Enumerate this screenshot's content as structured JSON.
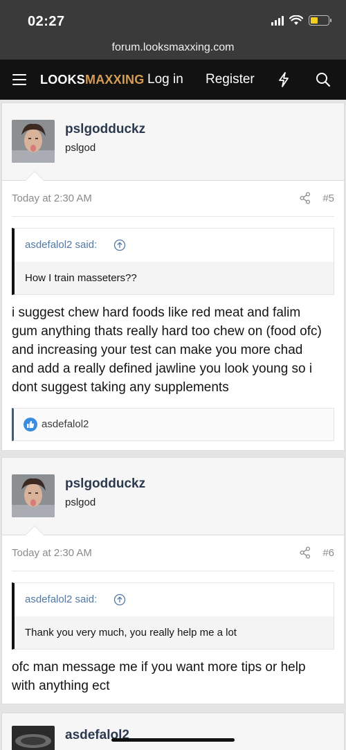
{
  "status_bar": {
    "time": "02:27"
  },
  "browser": {
    "url": "forum.looksmaxxing.com"
  },
  "nav": {
    "logo_part1": "LOOKS",
    "logo_part2": "MAXXING",
    "login": "Log in",
    "register": "Register"
  },
  "posts": [
    {
      "username": "pslgodduckz",
      "user_title": "pslgod",
      "date": "Today at 2:30 AM",
      "post_number": "#5",
      "quote_author": "asdefalol2 said:",
      "quote_text": "How I train masseters??",
      "message": "i suggest chew hard foods like red meat and falim gum anything thats really hard too chew on (food ofc) and increasing your test can make you more chad and add a really defined jawline you look young so i dont suggest taking any supplements",
      "reaction_user": "asdefalol2"
    },
    {
      "username": "pslgodduckz",
      "user_title": "pslgod",
      "date": "Today at 2:30 AM",
      "post_number": "#6",
      "quote_author": "asdefalol2 said:",
      "quote_text": "Thank you very much, you really help me a lot",
      "message": "ofc man message me if you want more tips or help with anything ect"
    },
    {
      "username": "asdefalol2"
    }
  ],
  "colors": {
    "nav_bg": "#121212",
    "logo_accent": "#d49c55",
    "username": "#2b3a4e",
    "quote_link": "#5278a0",
    "like": "#3b8de0"
  }
}
